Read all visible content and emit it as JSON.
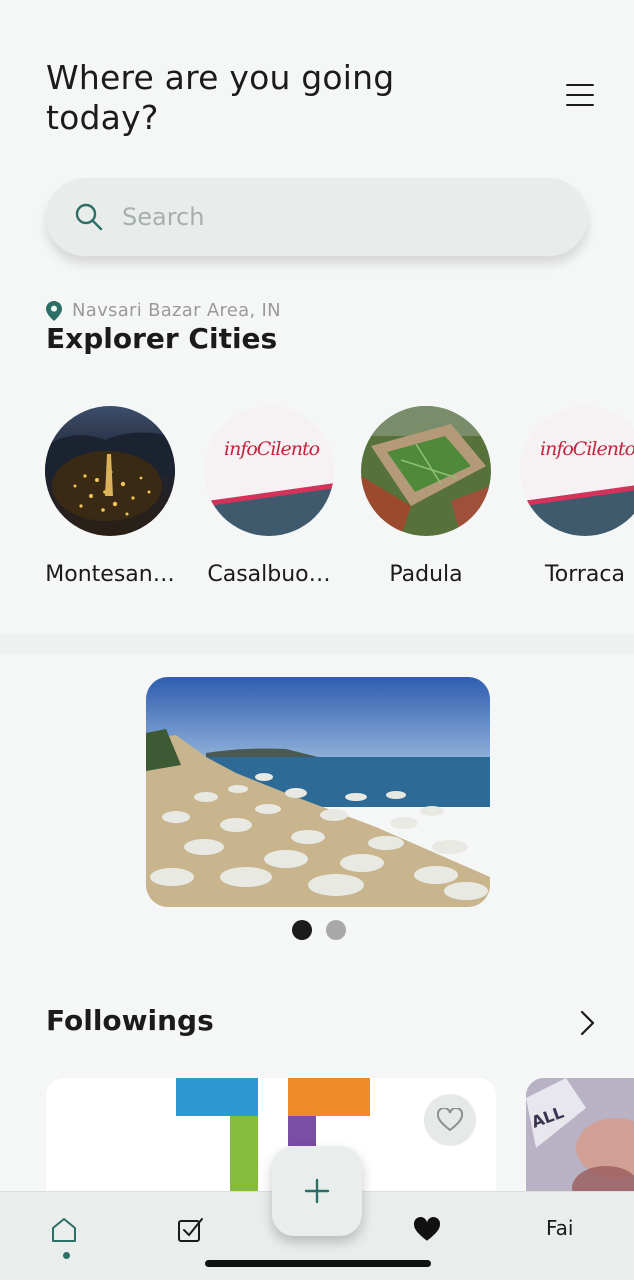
{
  "header": {
    "title": "Where are you going today?"
  },
  "search": {
    "placeholder": "Search"
  },
  "location": {
    "text": "Navsari Bazar Area, IN"
  },
  "explorer": {
    "title": "Explorer Cities",
    "cities": [
      {
        "name": "Montesan…",
        "image": "night-town-photo"
      },
      {
        "name": "Casalbuo…",
        "image": "infocilento-logo"
      },
      {
        "name": "Padula",
        "image": "monastery-aerial-photo"
      },
      {
        "name": "Torraca",
        "image": "infocilento-logo"
      }
    ],
    "logo_text": "infoCilento"
  },
  "banner": {
    "image": "beach-umbrellas-photo",
    "slides": 2,
    "active_slide": 1
  },
  "followings": {
    "title": "Followings"
  },
  "nav": {
    "fai_label": "Fai"
  },
  "colors": {
    "accent": "#2d6e66",
    "background": "#f5f7f7",
    "surface": "#e9eeed"
  }
}
